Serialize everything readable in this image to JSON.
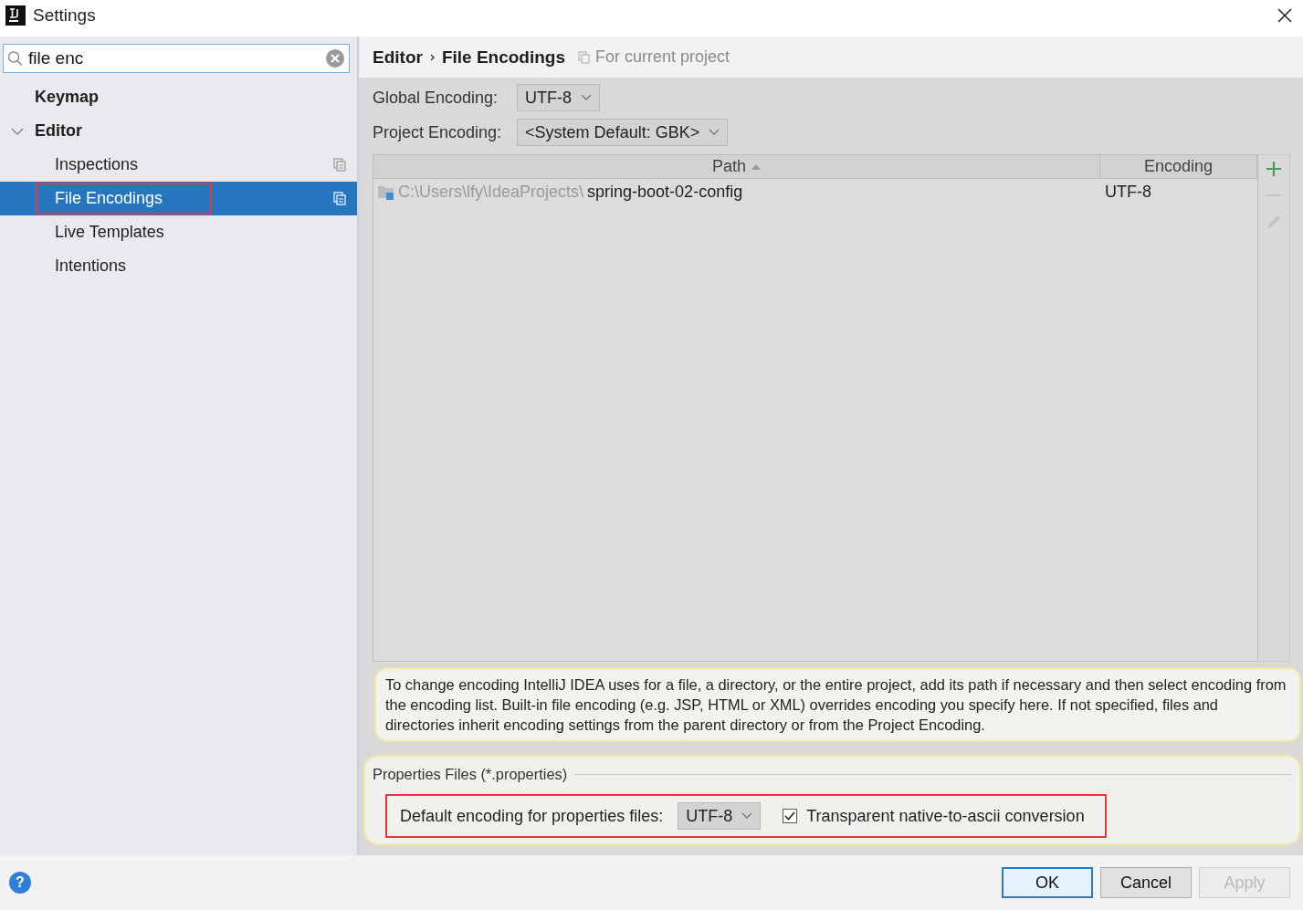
{
  "window": {
    "title": "Settings"
  },
  "search": {
    "value": "file enc"
  },
  "sidebar": {
    "items": [
      {
        "label": "Keymap",
        "selected": false,
        "highlighted": false,
        "project_scoped": false
      },
      {
        "label": "Editor",
        "selected": false,
        "highlighted": false,
        "project_scoped": false,
        "expanded": true,
        "children": [
          {
            "label": "Inspections",
            "selected": false,
            "highlighted": false,
            "project_scoped": true
          },
          {
            "label": "File Encodings",
            "selected": true,
            "highlighted": true,
            "project_scoped": true
          },
          {
            "label": "Live Templates",
            "selected": false,
            "highlighted": false,
            "project_scoped": false
          },
          {
            "label": "Intentions",
            "selected": false,
            "highlighted": false,
            "project_scoped": false
          }
        ]
      }
    ]
  },
  "content": {
    "breadcrumb": [
      "Editor",
      "File Encodings"
    ],
    "scope": "For current project",
    "fields": [
      {
        "label": "Global Encoding:",
        "value": "UTF-8"
      },
      {
        "label": "Project Encoding:",
        "value": "<System Default: GBK>"
      }
    ],
    "table": {
      "columns": [
        {
          "label": "Path",
          "sorted": true
        },
        {
          "label": "Encoding",
          "sorted": false
        }
      ],
      "rows": [
        {
          "path_prefix": "C:\\Users\\lfy\\IdeaProjects\\",
          "path_name": "spring-boot-02-config",
          "encoding": "UTF-8"
        }
      ],
      "tools": [
        {
          "kind": "add",
          "disabled": false
        },
        {
          "kind": "remove",
          "disabled": true
        },
        {
          "kind": "edit",
          "disabled": true
        }
      ]
    },
    "info": "To change encoding IntelliJ IDEA uses for a file, a directory, or the entire project, add its path if necessary and then select encoding from the encoding list. Built-in file encoding (e.g. JSP, HTML or XML) overrides encoding you specify here. If not specified, files and directories inherit encoding settings from the parent directory or from the Project Encoding.",
    "properties": {
      "title": "Properties Files (*.properties)",
      "label": "Default encoding for properties files:",
      "value": "UTF-8",
      "checkbox": {
        "label": "Transparent native-to-ascii conversion",
        "checked": true
      },
      "highlighted": true
    }
  },
  "help": "?",
  "buttons": [
    {
      "label": "OK",
      "default": true,
      "disabled": false
    },
    {
      "label": "Cancel",
      "default": false,
      "disabled": false
    },
    {
      "label": "Apply",
      "default": false,
      "disabled": true
    }
  ]
}
